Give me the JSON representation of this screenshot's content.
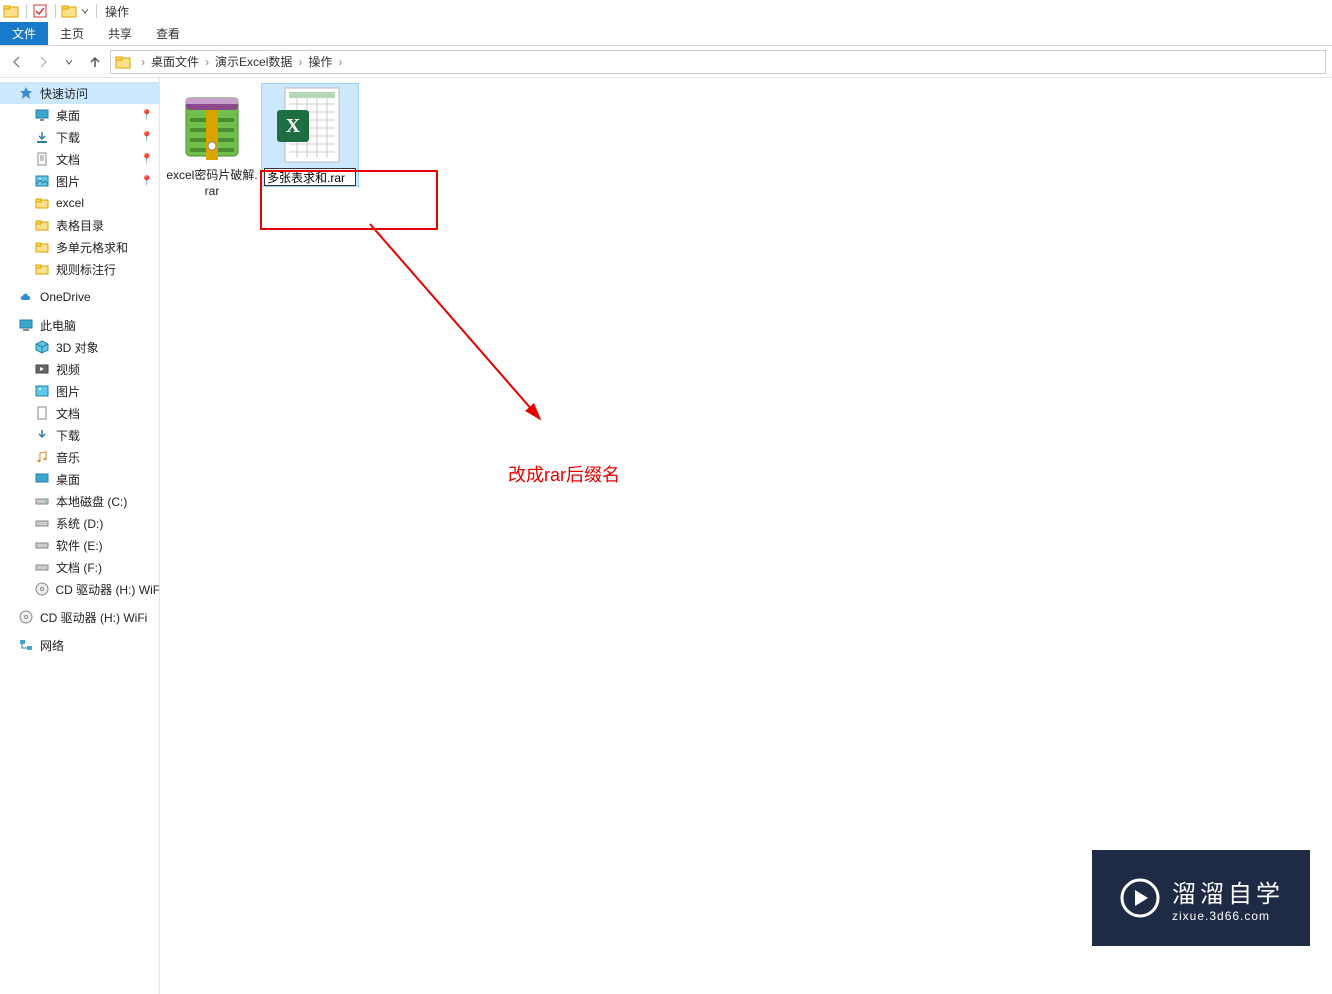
{
  "titlebar": {
    "title": "操作"
  },
  "ribbon": {
    "file": "文件",
    "tabs": [
      "主页",
      "共享",
      "查看"
    ]
  },
  "breadcrumb": {
    "items": [
      "桌面文件",
      "演示Excel数据",
      "操作"
    ]
  },
  "sidebar": {
    "quick_access": {
      "label": "快速访问"
    },
    "quick_items": [
      {
        "label": "桌面",
        "icon": "desktop",
        "pinned": true
      },
      {
        "label": "下载",
        "icon": "download",
        "pinned": true
      },
      {
        "label": "文档",
        "icon": "document",
        "pinned": true
      },
      {
        "label": "图片",
        "icon": "pictures",
        "pinned": true
      },
      {
        "label": "excel",
        "icon": "folder",
        "pinned": false
      },
      {
        "label": "表格目录",
        "icon": "folder",
        "pinned": false
      },
      {
        "label": "多单元格求和",
        "icon": "folder",
        "pinned": false
      },
      {
        "label": "规则标注行",
        "icon": "folder",
        "pinned": false
      }
    ],
    "onedrive": {
      "label": "OneDrive"
    },
    "this_pc": {
      "label": "此电脑"
    },
    "pc_items": [
      {
        "label": "3D 对象",
        "icon": "3d"
      },
      {
        "label": "视频",
        "icon": "video"
      },
      {
        "label": "图片",
        "icon": "pictures"
      },
      {
        "label": "文档",
        "icon": "document"
      },
      {
        "label": "下载",
        "icon": "download"
      },
      {
        "label": "音乐",
        "icon": "music"
      },
      {
        "label": "桌面",
        "icon": "desktop"
      },
      {
        "label": "本地磁盘 (C:)",
        "icon": "drive"
      },
      {
        "label": "系统 (D:)",
        "icon": "drive"
      },
      {
        "label": "软件 (E:)",
        "icon": "drive"
      },
      {
        "label": "文档 (F:)",
        "icon": "drive"
      },
      {
        "label": "CD 驱动器 (H:) WiFi",
        "icon": "disc"
      }
    ],
    "extra": [
      {
        "label": "CD 驱动器 (H:) WiFi",
        "icon": "disc"
      }
    ],
    "network": {
      "label": "网络"
    }
  },
  "files": {
    "items": [
      {
        "label": "excel密码片破解.rar",
        "type": "rar"
      },
      {
        "label": "多张表求和.rar",
        "type": "xlsx",
        "editing": true,
        "selected": true
      }
    ]
  },
  "annotation": {
    "text": "改成rar后缀名"
  },
  "watermark": {
    "main": "溜溜自学",
    "sub": "zixue.3d66.com"
  },
  "icons": {
    "back": "←",
    "forward": "→",
    "up": "↑",
    "chevron": "›",
    "dropdown": "▾",
    "pin": "📌"
  }
}
